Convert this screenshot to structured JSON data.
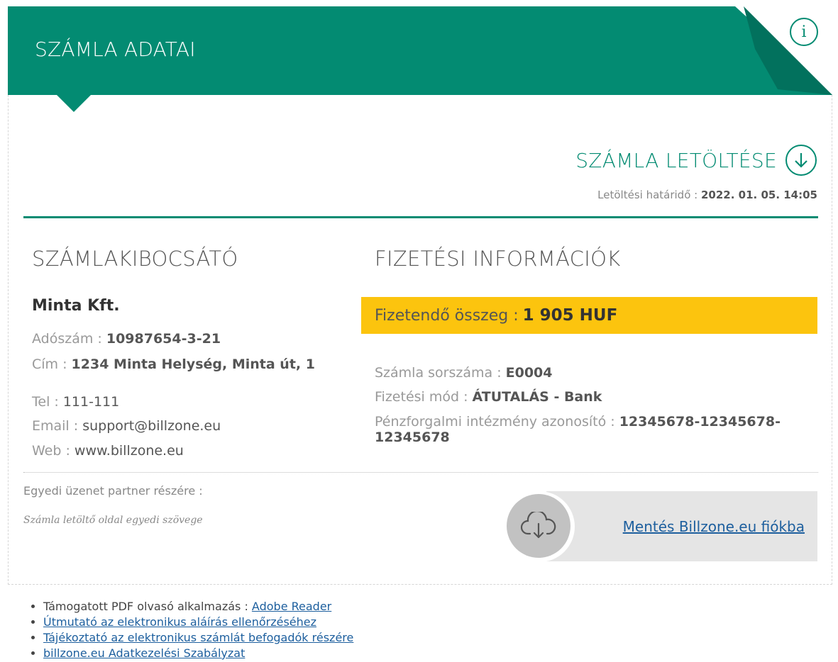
{
  "header": {
    "title": "SZÁMLA ADATAI",
    "info_icon": "info-icon",
    "info_glyph": "i",
    "color": "#038b72"
  },
  "download": {
    "label": "SZÁMLA LETÖLTÉSE",
    "icon": "arrow-down-circle-icon",
    "deadline_label": "Letöltési határidő",
    "deadline_value": "2022. 01. 05. 14:05"
  },
  "issuer": {
    "title": "SZÁMLAKIBOCSÁTÓ",
    "company": "Minta Kft.",
    "tax_label": "Adószám",
    "tax_value": "10987654-3-21",
    "address_label": "Cím",
    "address_value": "1234 Minta Helység, Minta út, 1",
    "tel_label": "Tel",
    "tel_value": "111-111",
    "email_label": "Email",
    "email_value": "support@billzone.eu",
    "web_label": "Web",
    "web_value": "www.billzone.eu"
  },
  "payment": {
    "title": "FIZETÉSI INFORMÁCIÓK",
    "amount_label": "Fizetendő összeg",
    "amount_value": "1 905 HUF",
    "amount_color": "#fcc40e",
    "serial_label": "Számla sorszáma",
    "serial_value": "E0004",
    "method_label": "Fizetési mód",
    "method_value": "ÁTUTALÁS - Bank",
    "bank_label": "Pénzforgalmi intézmény azonosító",
    "bank_value": "12345678-12345678-12345678"
  },
  "message": {
    "label": "Egyedi üzenet partner részére :",
    "text": "Számla letöltő oldal egyedi szövege"
  },
  "save": {
    "icon": "cloud-download-icon",
    "link": "Mentés Billzone.eu fiókba"
  },
  "footer": {
    "pdf_reader_label": "Támogatott PDF olvasó alkalmazás :",
    "pdf_reader_link": "Adobe Reader",
    "signature_guide": "Útmutató az elektronikus aláírás ellenőrzéséhez",
    "receiver_info": "Tájékoztató az elektronikus számlát befogadók részére",
    "privacy_policy": "billzone.eu Adatkezelési Szabályzat"
  },
  "colors": {
    "accent": "#038b72",
    "accent_dark": "#02715d",
    "link": "#1d5f9e"
  }
}
